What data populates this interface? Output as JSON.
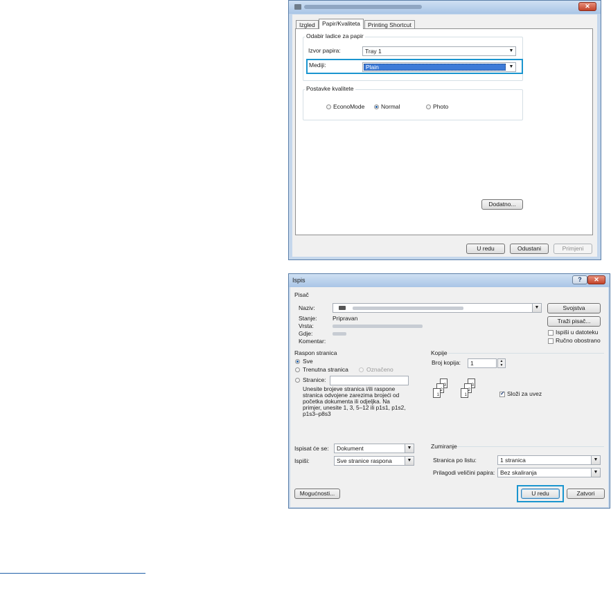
{
  "dialog1": {
    "tabs": [
      "Izgled",
      "Papir/Kvaliteta",
      "Printing Shortcut"
    ],
    "active_tab": 1,
    "paper_group": {
      "label": "Odabir ladice za papir",
      "source_label": "Izvor papira:",
      "source_value": "Tray 1",
      "media_label": "Mediji:",
      "media_value": "Plain"
    },
    "quality_group": {
      "label": "Postavke kvalitete",
      "options": [
        "EconoMode",
        "Normal",
        "Photo"
      ],
      "selected": "Normal"
    },
    "advanced_button": "Dodatno...",
    "buttons": {
      "ok": "U redu",
      "cancel": "Odustani",
      "apply": "Primjeni"
    },
    "close_glyph": "✕"
  },
  "dialog2": {
    "title": "Ispis",
    "help_glyph": "?",
    "close_glyph": "✕",
    "printer": {
      "section": "Pisač",
      "name_label": "Naziv:",
      "status_label": "Stanje:",
      "status_value": "Pripravan",
      "type_label": "Vrsta:",
      "where_label": "Gdje:",
      "comment_label": "Komentar:",
      "properties_button": "Svojstva",
      "find_button": "Traži pisač...",
      "print_to_file": "Ispiši u datoteku",
      "manual_duplex": "Ručno obostrano"
    },
    "range": {
      "label": "Raspon stranica",
      "all": "Sve",
      "current": "Trenutna stranica",
      "selection": "Označeno",
      "pages": "Stranice:",
      "help": [
        "Unesite brojeve stranica i/ili raspone",
        "stranica odvojene zarezima brojeći od",
        "početka dokumenta ili odjeljka. Na",
        "primjer, unesite 1, 3, 5–12 ili p1s1, p1s2,",
        "p1s3–p8s3"
      ]
    },
    "copies": {
      "label": "Kopije",
      "count_label": "Broj kopija:",
      "count_value": "1",
      "collate": "Složi za uvez",
      "page_nums": [
        "3",
        "2",
        "1",
        "3",
        "2",
        "1"
      ]
    },
    "print_what_label": "Ispisat će se:",
    "print_what_value": "Dokument",
    "print_label": "Ispiši:",
    "print_value": "Sve stranice raspona",
    "zoom": {
      "label": "Zumiranje",
      "pages_per_sheet_label": "Stranica po listu:",
      "pages_per_sheet_value": "1 stranica",
      "scale_label": "Prilagodi veličini papira:",
      "scale_value": "Bez skaliranja"
    },
    "options_button": "Mogućnosti...",
    "ok_button": "U redu",
    "close_button": "Zatvori"
  }
}
